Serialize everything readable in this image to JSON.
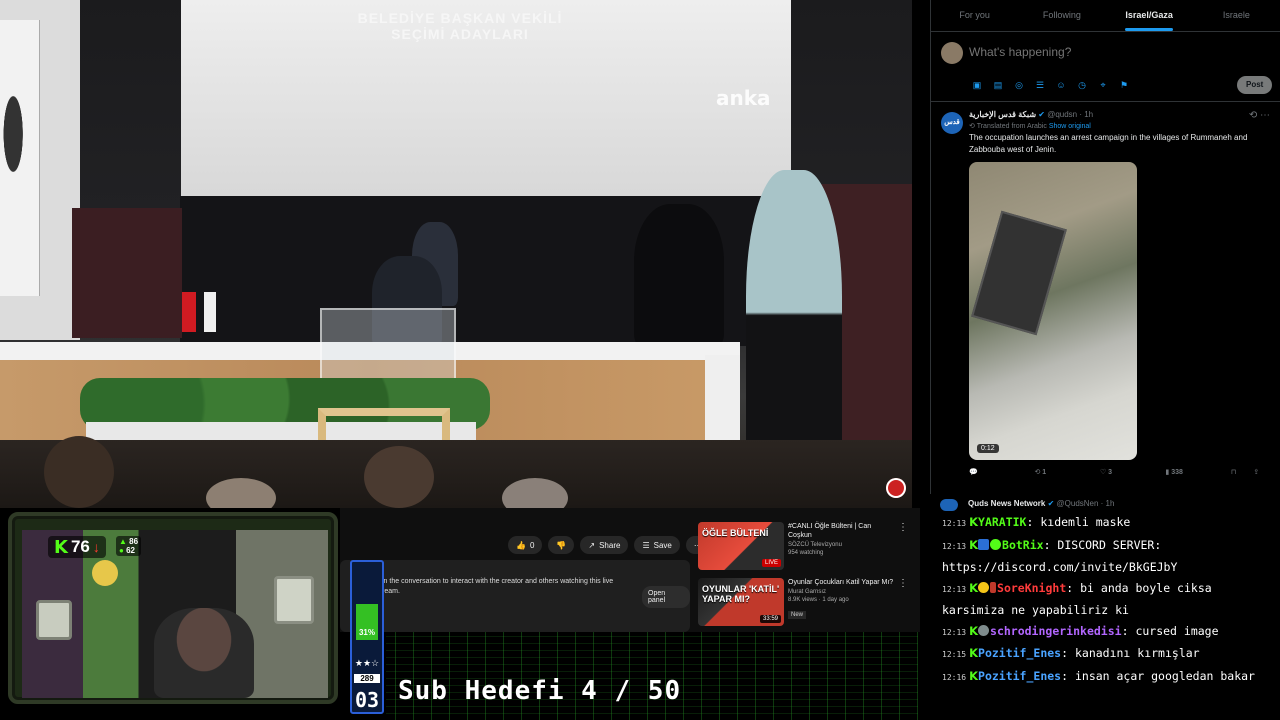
{
  "video": {
    "screen_title": "BELEDİYE BAŞKAN VEKİLİ SEÇİMİ ADAYLARI",
    "watermark": "anka"
  },
  "youtube": {
    "actions": {
      "like_count": "0",
      "share_label": "Share",
      "save_label": "Save",
      "more_label": "⋯"
    },
    "chat": {
      "line1": "t",
      "line2": "in the conversation to interact with the creator and others watching this live",
      "line3": "ream.",
      "open_panel_label": "Open panel"
    },
    "recommendations": [
      {
        "thumb_text": "ÖĞLE BÜLTENİ",
        "badge": "LIVE",
        "title": "#CANLI Öğle Bülteni | Can Coşkun",
        "channel": "SÖZCÜ Televizyonu",
        "meta": "954 watching"
      },
      {
        "thumb_text": "OYUNLAR 'KATİL' YAPAR MI?",
        "duration": "33:59",
        "title": "Oyunlar Çocukları Katil Yapar Mı?",
        "channel": "Murat Garnsız",
        "meta": "8.9K views · 1 day ago",
        "tag": "New"
      }
    ]
  },
  "webcam": {
    "kick_viewers": "76",
    "stat_top": "86",
    "stat_bottom": "62"
  },
  "subgoal": {
    "percent": "31%",
    "fill_fraction": 0.31,
    "count": "289",
    "level": "03",
    "text": "Sub Hedefi 4 / 50"
  },
  "x": {
    "tabs": [
      "For you",
      "Following",
      "Israel/Gaza",
      "Israele"
    ],
    "active_tab": 2,
    "compose_placeholder": "What's happening?",
    "post_label": "Post",
    "tweet": {
      "avatar_text": "قدس",
      "name": "شبكة قدس الإخبارية",
      "handle": "@qudsn · 1h",
      "translated_label": "Translated from Arabic",
      "show_original": "Show original",
      "body": "The occupation launches an arrest campaign in the villages of Rummaneh and Zabbouba west of Jenin.",
      "video_duration": "0:12",
      "retweets": "1",
      "likes": "3",
      "views": "338"
    }
  },
  "chat": {
    "header_name": "Quds News Network",
    "header_handle": "@QudsNen · 1h",
    "messages": [
      {
        "ts": "12:13",
        "user": "YARATIK",
        "user_color": "#53fc18",
        "text": "kıdemli maske"
      },
      {
        "ts": "12:13",
        "user": "BotRix",
        "user_color": "#53fc18",
        "text": "DISCORD SERVER: https://discord.com/invite/BkGEJbY"
      },
      {
        "ts": "12:13",
        "user": "SoreKnight",
        "user_color": "#ff3b3b",
        "text": "bi anda boyle ciksa karsimiza ne yapabiliriz ki"
      },
      {
        "ts": "12:13",
        "user": "schrodingerinkedisi",
        "user_color": "#b266ff",
        "text": "cursed image"
      },
      {
        "ts": "12:15",
        "user": "Pozitif_Enes",
        "user_color": "#4aa3ff",
        "text": "kanadını kırmışlar"
      },
      {
        "ts": "12:16",
        "user": "Pozitif_Enes",
        "user_color": "#4aa3ff",
        "text": "insan açar googledan bakar"
      }
    ]
  }
}
